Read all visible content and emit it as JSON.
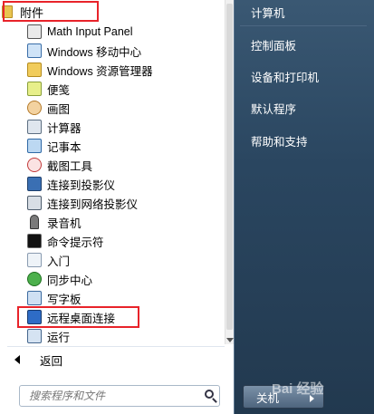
{
  "programs": {
    "folder_label": "附件",
    "items": [
      {
        "label": "Math Input Panel",
        "icon": "math-input-icon"
      },
      {
        "label": "Windows 移动中心",
        "icon": "mobility-center-icon"
      },
      {
        "label": "Windows 资源管理器",
        "icon": "explorer-folder-icon"
      },
      {
        "label": "便笺",
        "icon": "sticky-notes-icon"
      },
      {
        "label": "画图",
        "icon": "paint-icon"
      },
      {
        "label": "计算器",
        "icon": "calculator-icon"
      },
      {
        "label": "记事本",
        "icon": "notepad-icon"
      },
      {
        "label": "截图工具",
        "icon": "snipping-tool-icon"
      },
      {
        "label": "连接到投影仪",
        "icon": "projector-icon"
      },
      {
        "label": "连接到网络投影仪",
        "icon": "network-projector-icon"
      },
      {
        "label": "录音机",
        "icon": "sound-recorder-icon"
      },
      {
        "label": "命令提示符",
        "icon": "command-prompt-icon"
      },
      {
        "label": "入门",
        "icon": "getting-started-icon"
      },
      {
        "label": "同步中心",
        "icon": "sync-center-icon"
      },
      {
        "label": "写字板",
        "icon": "wordpad-icon"
      },
      {
        "label": "远程桌面连接",
        "icon": "remote-desktop-icon"
      },
      {
        "label": "运行",
        "icon": "run-icon"
      }
    ],
    "back_label": "返回"
  },
  "search": {
    "placeholder": "搜索程序和文件"
  },
  "right_pane": {
    "links": [
      "计算机",
      "控制面板",
      "设备和打印机",
      "默认程序",
      "帮助和支持"
    ]
  },
  "shutdown": {
    "label": "关机"
  },
  "watermark": "Bai 经验",
  "colors": {
    "highlight_border": "#e8232a",
    "right_pane": "#2a4660"
  }
}
